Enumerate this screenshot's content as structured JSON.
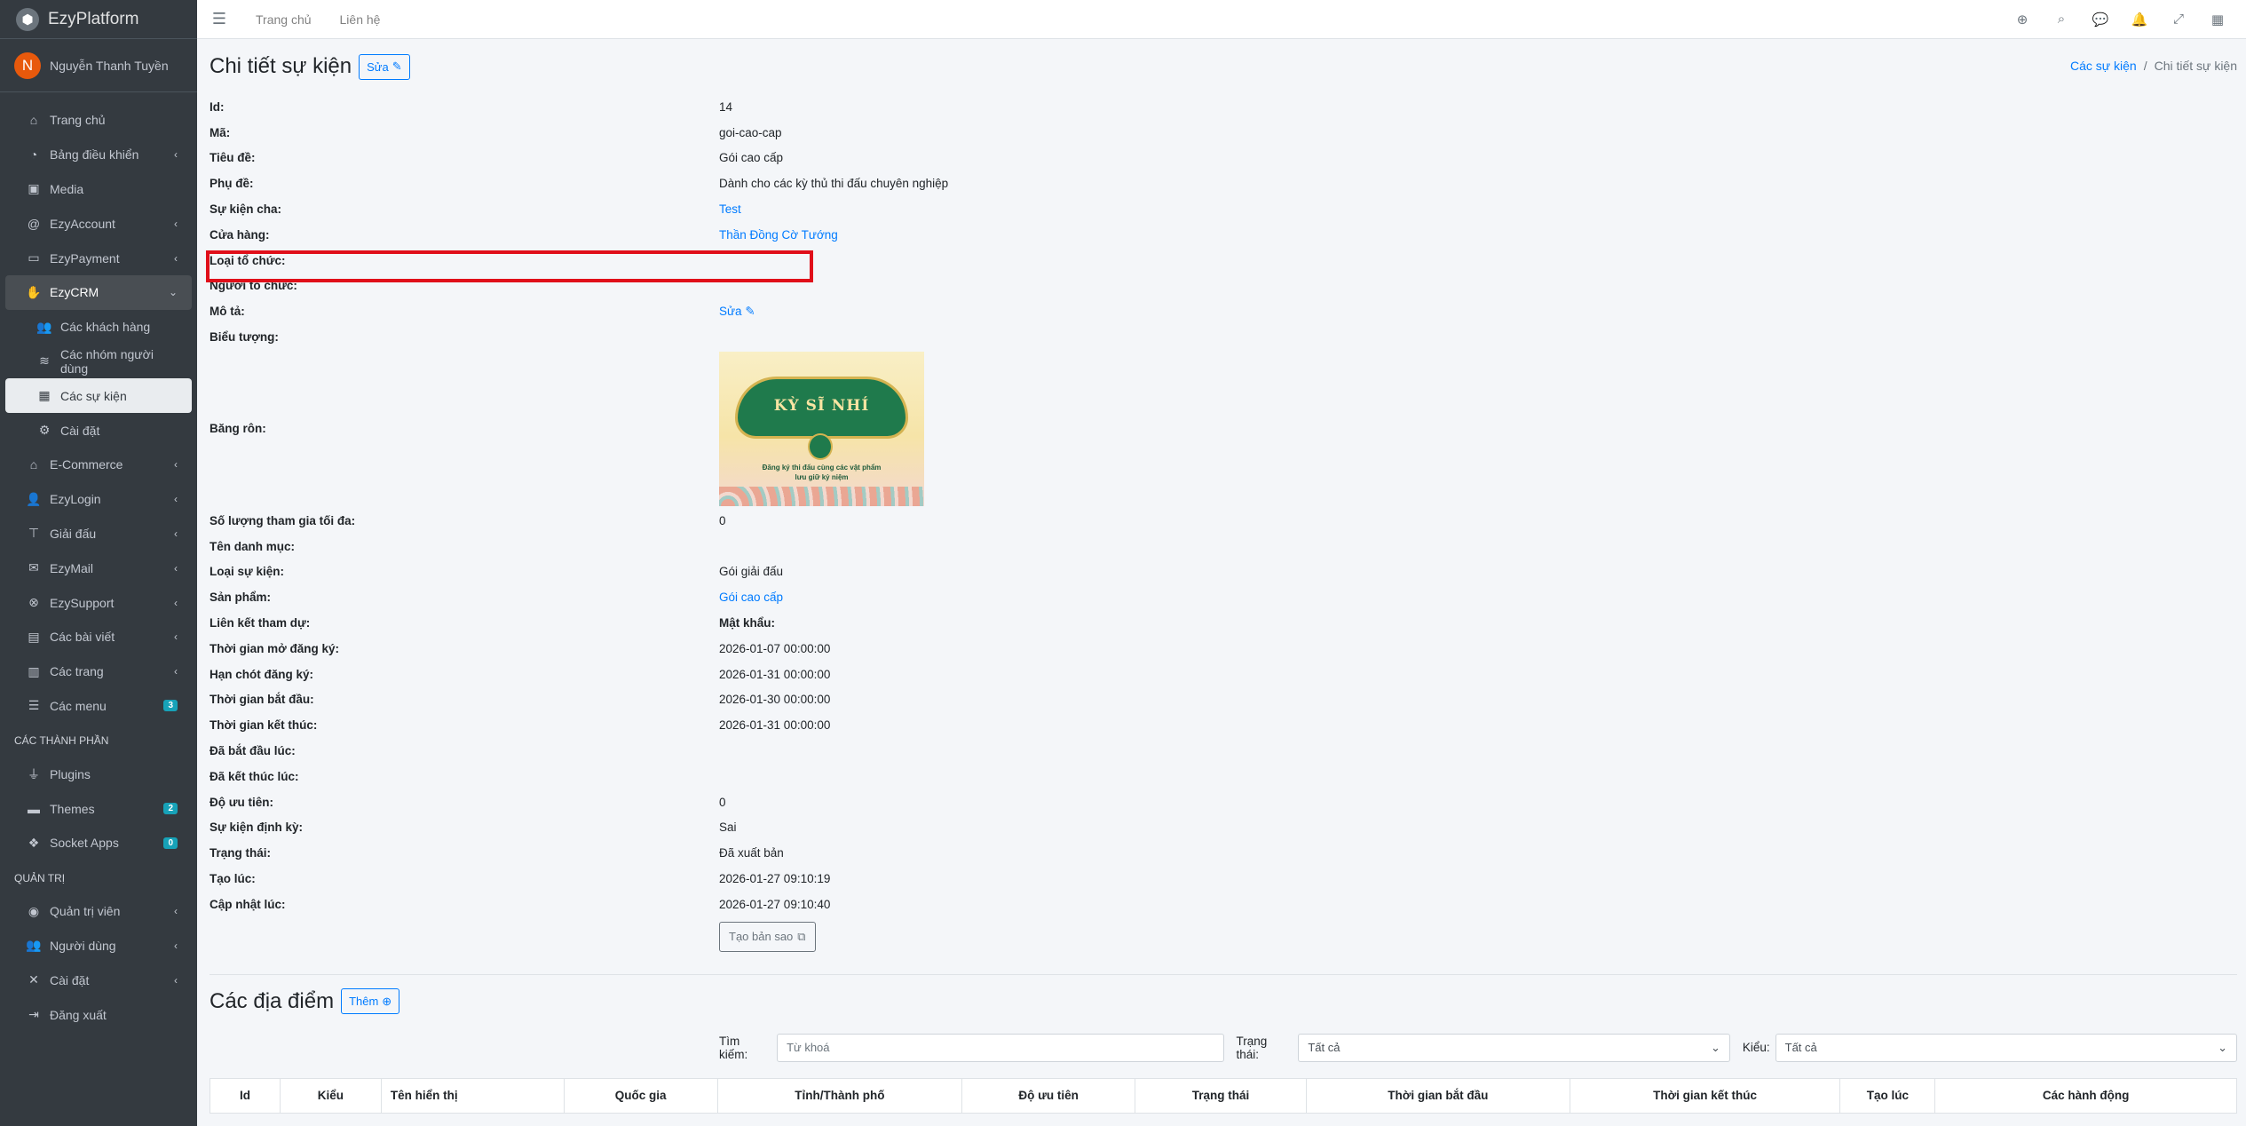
{
  "brand": {
    "name": "EzyPlatform",
    "logo": "cube-icon"
  },
  "user": {
    "initial": "N",
    "name": "Nguyễn Thanh Tuyền"
  },
  "sidebar": {
    "items": [
      {
        "label": "Trang chủ",
        "icon": "home-icon"
      },
      {
        "label": "Bảng điều khiển",
        "icon": "dashboard-icon"
      },
      {
        "label": "Media",
        "icon": "image-icon"
      },
      {
        "label": "EzyAccount",
        "icon": "at-icon"
      },
      {
        "label": "EzyPayment",
        "icon": "credit-card-icon"
      },
      {
        "label": "EzyCRM",
        "icon": "handshake-icon"
      },
      {
        "label": "Các khách hàng",
        "icon": "users-icon"
      },
      {
        "label": "Các nhóm người dùng",
        "icon": "layers-icon"
      },
      {
        "label": "Các sự kiện",
        "icon": "calendar-icon"
      },
      {
        "label": "Cài đặt",
        "icon": "cogs-icon"
      },
      {
        "label": "E-Commerce",
        "icon": "shop-icon"
      },
      {
        "label": "EzyLogin",
        "icon": "user-lock-icon"
      },
      {
        "label": "Giải đấu",
        "icon": "sitemap-icon"
      },
      {
        "label": "EzyMail",
        "icon": "envelope-icon"
      },
      {
        "label": "EzySupport",
        "icon": "lifebuoy-icon"
      },
      {
        "label": "Các bài viết",
        "icon": "newspaper-icon"
      },
      {
        "label": "Các trang",
        "icon": "columns-icon"
      },
      {
        "label": "Các menu",
        "icon": "bars-icon",
        "badge": "3"
      }
    ],
    "section_components": "CÁC THÀNH PHẦN",
    "components": [
      {
        "label": "Plugins",
        "icon": "plug-icon"
      },
      {
        "label": "Themes",
        "icon": "palette-icon",
        "badge": "2"
      },
      {
        "label": "Socket Apps",
        "icon": "cubes-icon",
        "badge": "0"
      }
    ],
    "section_admin": "QUẢN TRỊ",
    "admin": [
      {
        "label": "Quản trị viên",
        "icon": "user-circle-icon"
      },
      {
        "label": "Người dùng",
        "icon": "users-icon"
      },
      {
        "label": "Cài đặt",
        "icon": "tools-icon"
      },
      {
        "label": "Đăng xuất",
        "icon": "sign-out-icon"
      }
    ]
  },
  "topbar": {
    "home": "Trang chủ",
    "contact": "Liên hệ"
  },
  "page": {
    "title": "Chi tiết sự kiện",
    "edit_label": "Sửa",
    "breadcrumb": {
      "parent": "Các sự kiện",
      "sep": "/",
      "current": "Chi tiết sự kiện"
    }
  },
  "details": [
    {
      "label": "Id:",
      "value": "14"
    },
    {
      "label": "Mã:",
      "value": "goi-cao-cap"
    },
    {
      "label": "Tiêu đề:",
      "value": "Gói cao cấp"
    },
    {
      "label": "Phụ đề:",
      "value": "Dành cho các kỳ thủ thi đấu chuyên nghiệp"
    },
    {
      "label": "Sự kiện cha:",
      "value": "Test"
    },
    {
      "label": "Cửa hàng:",
      "value": "Thần Đồng Cờ Tướng"
    },
    {
      "label": "Loại tổ chức:",
      "value": ""
    },
    {
      "label": "Người tổ chức:",
      "value": ""
    },
    {
      "label": "Mô tả:",
      "value": "Sửa"
    },
    {
      "label": "Biểu tượng:",
      "value": ""
    },
    {
      "label": "Băng rôn:",
      "value": ""
    },
    {
      "label": "Số lượng tham gia tối đa:",
      "value": "0"
    },
    {
      "label": "Tên danh mục:",
      "value": ""
    },
    {
      "label": "Loại sự kiện:",
      "value": "Gói giải đấu"
    },
    {
      "label": "Sản phẩm:",
      "value": "Gói cao cấp"
    },
    {
      "label": "Liên kết tham dự:",
      "value": "Mật khẩu:"
    },
    {
      "label": "Thời gian mở đăng ký:",
      "value": "2026-01-07 00:00:00"
    },
    {
      "label": "Hạn chót đăng ký:",
      "value": "2026-01-31 00:00:00"
    },
    {
      "label": "Thời gian bắt đầu:",
      "value": "2026-01-30 00:00:00"
    },
    {
      "label": "Thời gian kết thúc:",
      "value": "2026-01-31 00:00:00"
    },
    {
      "label": "Đã bắt đầu lúc:",
      "value": ""
    },
    {
      "label": "Đã kết thúc lúc:",
      "value": ""
    },
    {
      "label": "Độ ưu tiên:",
      "value": "0"
    },
    {
      "label": "Sự kiện định kỳ:",
      "value": "Sai"
    },
    {
      "label": "Trạng thái:",
      "value": "Đã xuất bản"
    },
    {
      "label": "Tạo lúc:",
      "value": "2026-01-27 09:10:19"
    },
    {
      "label": "Cập nhật lúc:",
      "value": "2026-01-27 09:10:40"
    }
  ],
  "banner": {
    "title": "KỲ SĨ NHÍ",
    "caption_line1": "Đăng ký thi đấu cùng các vật phẩm",
    "caption_line2": "lưu giữ kỷ niệm"
  },
  "copy_label": "Tạo bản sao",
  "locations": {
    "title": "Các địa điểm",
    "add_label": "Thêm",
    "search_label": "Tìm kiếm:",
    "search_placeholder": "Từ khoá",
    "status_label": "Trạng thái:",
    "status_value": "Tất cả",
    "type_label": "Kiểu:",
    "type_value": "Tất cả",
    "columns": [
      "Id",
      "Kiểu",
      "Tên hiển thị",
      "Quốc gia",
      "Tỉnh/Thành phố",
      "Độ ưu tiên",
      "Trạng thái",
      "Thời gian bắt đầu",
      "Thời gian kết thúc",
      "Tạo lúc",
      "Các hành động"
    ]
  },
  "colors": {
    "accent": "#007bff",
    "sidebar": "#343a40",
    "highlight": "#e00f1a"
  }
}
